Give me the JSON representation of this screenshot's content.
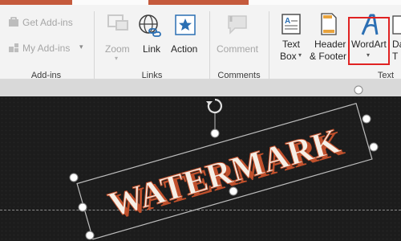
{
  "addins": {
    "get_addins": "Get Add-ins",
    "my_addins": "My Add-ins",
    "group_label": "Add-ins"
  },
  "links": {
    "zoom": "Zoom",
    "link": "Link",
    "action": "Action",
    "group_label": "Links"
  },
  "comments": {
    "comment": "Comment",
    "group_label": "Comments"
  },
  "text": {
    "text_box_1": "Text",
    "text_box_2": "Box",
    "header_footer_1": "Header",
    "header_footer_2": "& Footer",
    "wordart": "WordArt",
    "date_partial_1": "Da",
    "date_partial_2": "T",
    "group_label": "Text"
  },
  "slide": {
    "wordart_text": "WATERMARK"
  },
  "colors": {
    "accent": "#c55a3c",
    "highlight": "#e02222",
    "wordart_fill": "#f5efe6",
    "wordart_outline": "#c0502c"
  }
}
